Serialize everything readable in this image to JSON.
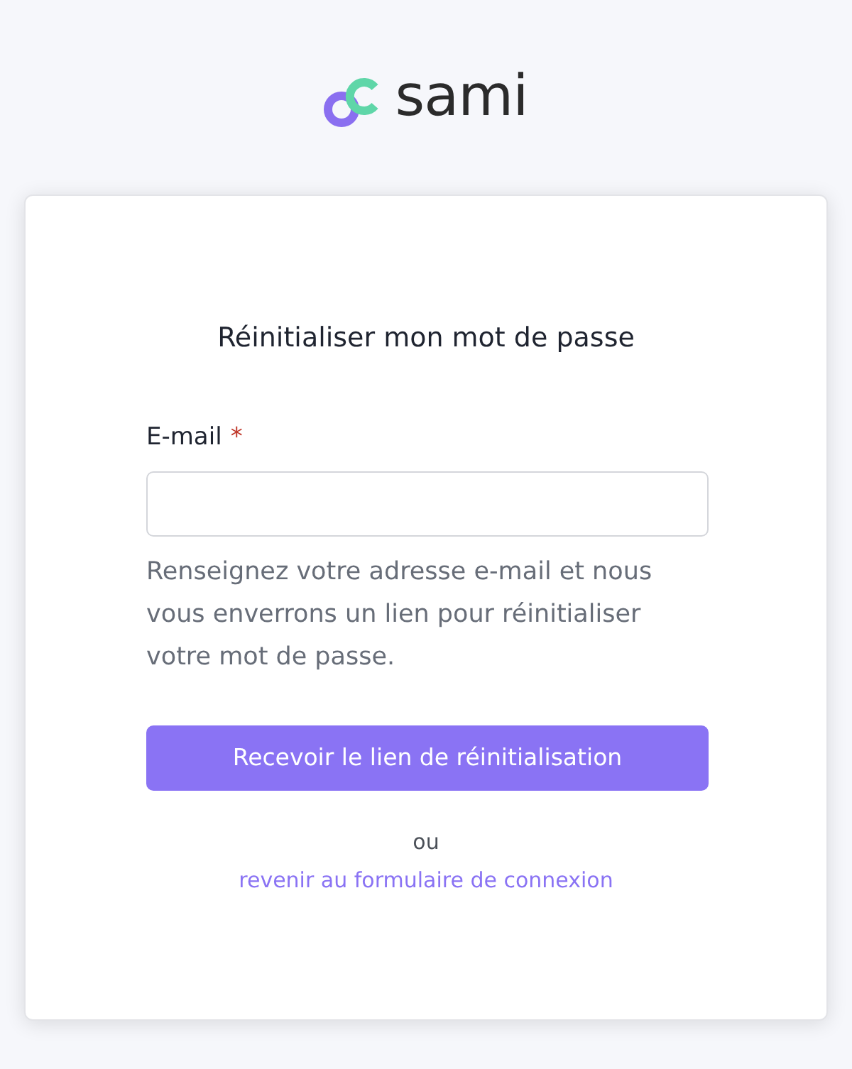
{
  "logo": {
    "text": "sami"
  },
  "form": {
    "title": "Réinitialiser mon mot de passe",
    "email_field": {
      "label": "E-mail",
      "required_mark": "*"
    },
    "help_text": "Renseignez votre adresse e-mail et nous vous enverrons un lien pour réinitialiser votre mot de passe.",
    "submit_button": "Recevoir le lien de réinitialisation",
    "separator": "ou",
    "back_link": "revenir au formulaire de connexion"
  }
}
